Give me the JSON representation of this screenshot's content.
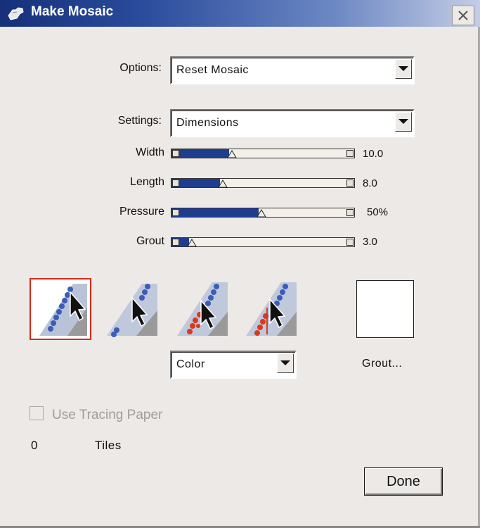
{
  "window": {
    "title": "Make Mosaic",
    "icon": "hand-pointer-icon",
    "close_icon": "close-icon"
  },
  "options": {
    "label": "Options:",
    "value": "Reset Mosaic"
  },
  "settings": {
    "label": "Settings:",
    "value": "Dimensions"
  },
  "sliders": [
    {
      "label": "Width",
      "value_text": "10.0",
      "fill": 0.33
    },
    {
      "label": "Length",
      "value_text": "8.0",
      "fill": 0.28
    },
    {
      "label": "Pressure",
      "value_text": "50%",
      "fill": 0.5
    },
    {
      "label": "Grout",
      "value_text": "3.0",
      "fill": 0.1
    }
  ],
  "tools": [
    {
      "name": "apply-tiles-tool",
      "selected": true
    },
    {
      "name": "erase-tiles-tool",
      "selected": false
    },
    {
      "name": "select-tiles-tool",
      "selected": false
    },
    {
      "name": "outline-tiles-tool",
      "selected": false
    }
  ],
  "color_select": {
    "value": "Color"
  },
  "grout_button": {
    "label": "Grout..."
  },
  "tracing_paper": {
    "label": "Use Tracing Paper",
    "checked": false,
    "enabled": false
  },
  "tile_count": {
    "value": "0",
    "label": "Tiles"
  },
  "done_button": {
    "label": "Done"
  },
  "colors": {
    "title_start": "#16307a",
    "slider_fill": "#1f3d8e",
    "selection": "#d62a1a",
    "tile_blue": "#3a5db8",
    "tile_red": "#d8391f"
  }
}
